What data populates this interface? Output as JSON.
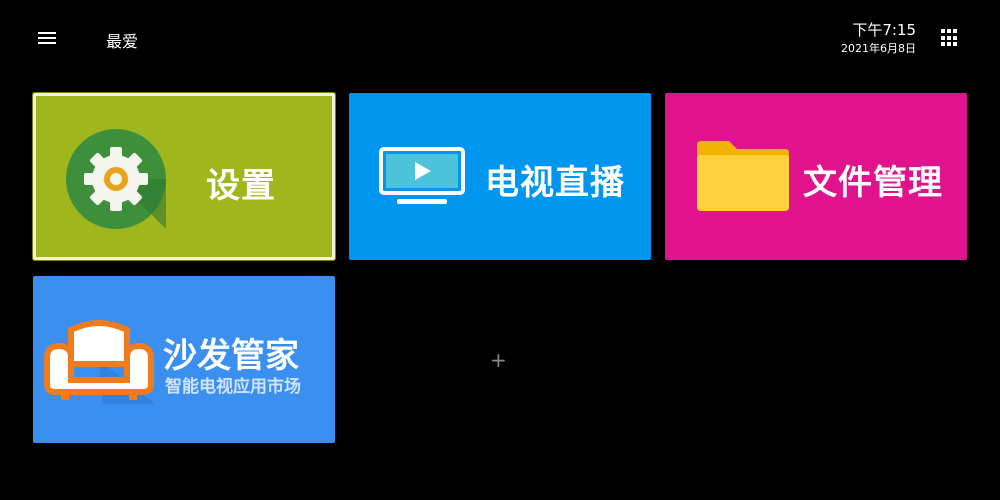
{
  "header": {
    "menu_icon": "hamburger-menu-icon",
    "title": "最爱",
    "time": "下午7:15",
    "date": "2021年6月8日",
    "apps_icon": "app-grid-icon"
  },
  "tiles": [
    {
      "label": "设置",
      "icon": "gear-icon",
      "color": "#9fb61d"
    },
    {
      "label": "电视直播",
      "icon": "tv-play-icon",
      "color": "#0096f0"
    },
    {
      "label": "文件管理",
      "icon": "folder-icon",
      "color": "#e0128c"
    },
    {
      "label": "沙发管家",
      "subtitle": "智能电视应用市场",
      "icon": "sofa-icon",
      "color": "#3a8ff0"
    }
  ],
  "add_slot": {
    "label": "+"
  }
}
